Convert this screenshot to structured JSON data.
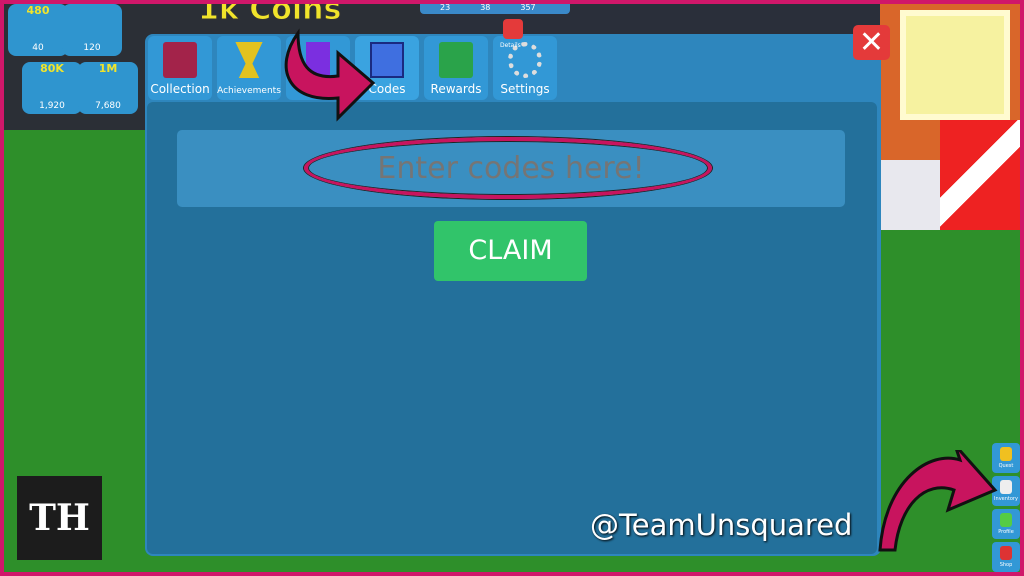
{
  "background": {
    "coins_title": "1k Coins",
    "top_stats": [
      "23",
      "38",
      "357"
    ],
    "shop_tiles": [
      {
        "title": "480",
        "price": "40"
      },
      {
        "title": "",
        "price": "120"
      },
      {
        "title": "80K",
        "price": "1,920"
      },
      {
        "title": "1M",
        "price": "7,680"
      }
    ]
  },
  "tabs": [
    {
      "label": "Collection",
      "icon": "book-icon"
    },
    {
      "label": "Achievements",
      "icon": "trophy-icon"
    },
    {
      "label": "",
      "icon": "upgrade-icon"
    },
    {
      "label": "Codes",
      "icon": "codes-icon"
    },
    {
      "label": "Rewards",
      "icon": "calendar-check-icon"
    },
    {
      "label": "Settings",
      "icon": "gear-wrench-icon"
    }
  ],
  "details_label": "Details",
  "close_label": "✕",
  "codes": {
    "placeholder": "Enter codes here!",
    "value": "",
    "claim_label": "CLAIM"
  },
  "watermark": "@TeamUnsquared",
  "logo": "TH",
  "side_buttons": [
    {
      "label": "Quest"
    },
    {
      "label": "Inventory"
    },
    {
      "label": "Profile"
    },
    {
      "label": "Shop"
    }
  ],
  "colors": {
    "panel": "#2e86bd",
    "inner": "#23709b",
    "claim": "#31c46a",
    "close": "#e43a3a",
    "annotation": "#c8145e"
  }
}
